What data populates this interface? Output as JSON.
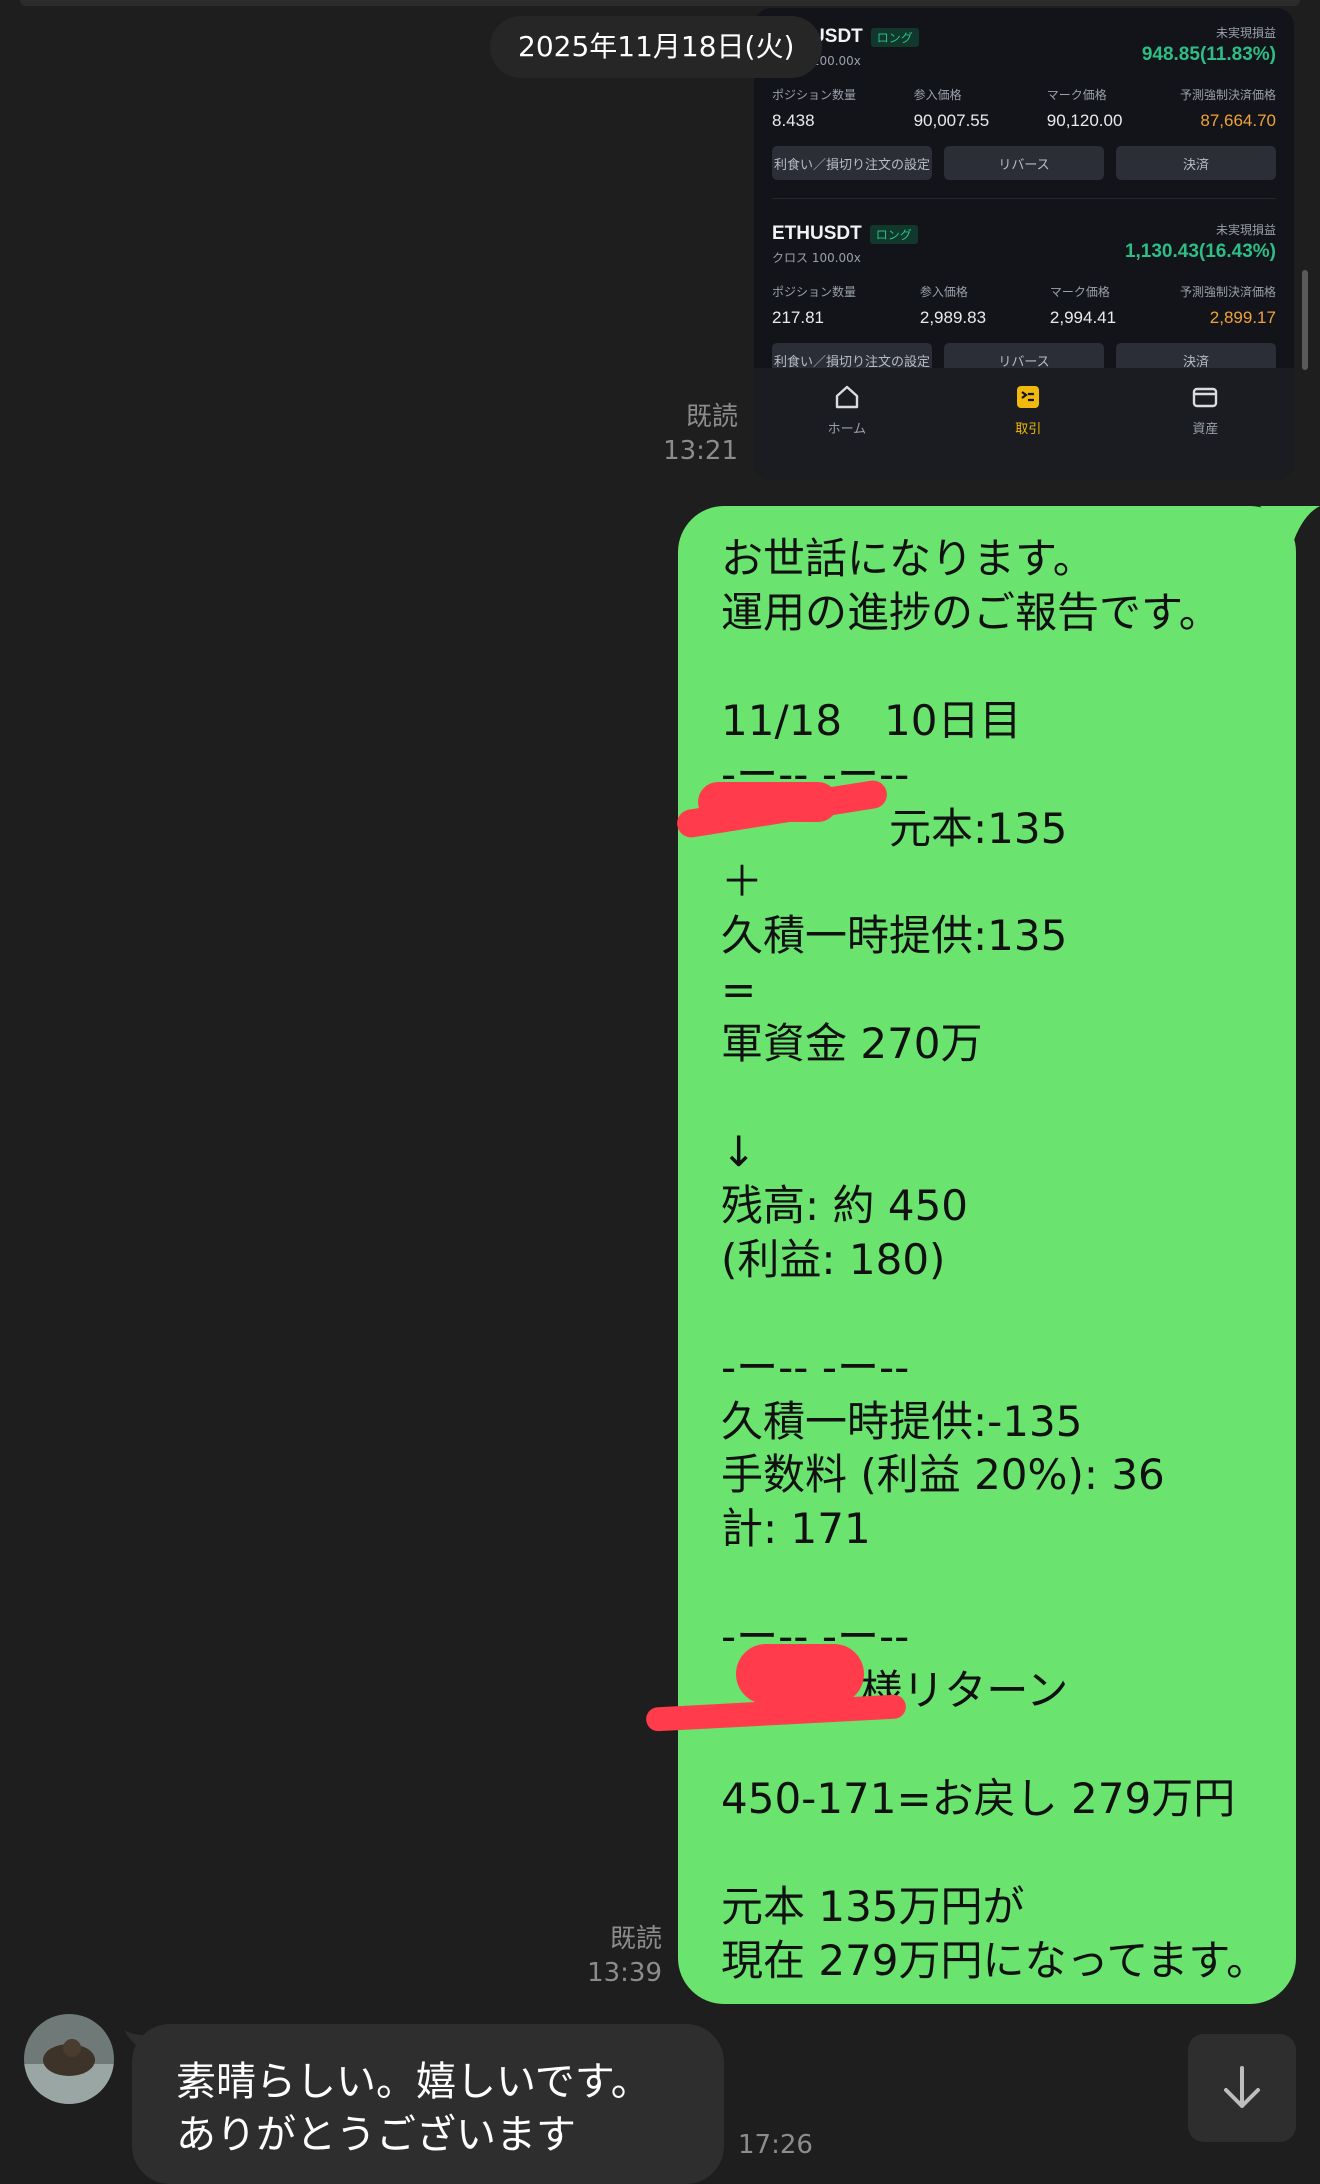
{
  "date_separator": "2025年11月18日(火)",
  "trade_screenshot": {
    "positions": [
      {
        "symbol": "BTCUSDT",
        "side": "ロング",
        "margin": "クロス 100.00x",
        "pnl_label": "未実現損益",
        "pnl_value": "948.85(11.83%)",
        "cols": [
          {
            "label": "ポジション数量",
            "value": "8.438"
          },
          {
            "label": "参入価格",
            "value": "90,007.55"
          },
          {
            "label": "マーク価格",
            "value": "90,120.00"
          },
          {
            "label": "予測強制決済価格",
            "value": "87,664.70"
          }
        ],
        "buttons": [
          "利食い／損切り注文の設定",
          "リバース",
          "決済"
        ]
      },
      {
        "symbol": "ETHUSDT",
        "side": "ロング",
        "margin": "クロス 100.00x",
        "pnl_label": "未実現損益",
        "pnl_value": "1,130.43(16.43%)",
        "cols": [
          {
            "label": "ポジション数量",
            "value": "217.81"
          },
          {
            "label": "参入価格",
            "value": "2,989.83"
          },
          {
            "label": "マーク価格",
            "value": "2,994.41"
          },
          {
            "label": "予測強制決済価格",
            "value": "2,899.17"
          }
        ],
        "buttons": [
          "利食い／損切り注文の設定",
          "リバース",
          "決済"
        ]
      }
    ],
    "tabbar": [
      {
        "label": "ホーム",
        "icon": "home-icon"
      },
      {
        "label": "取引",
        "icon": "trade-icon"
      },
      {
        "label": "資産",
        "icon": "wallet-icon"
      }
    ]
  },
  "msg1_meta": {
    "read": "既読",
    "time": "13:21"
  },
  "msg2": {
    "lines": [
      "お世話になります。",
      "運用の進捗のご報告です。",
      "",
      "11/18　10日目",
      "-ー-- -ー--",
      "　　　　元本:135",
      "＋",
      "久積一時提供:135",
      "=",
      "軍資金 270万",
      "",
      "↓",
      "残高: 約 450",
      "(利益: 180)",
      "",
      "-ー-- -ー--",
      "久積一時提供:-135",
      "手数料 (利益 20%): 36",
      "計: 171",
      "",
      "-ー-- -ー--",
      "　　　 様リターン",
      "",
      "450-171=お戻し 279万円",
      "",
      "元本 135万円が",
      "現在 279万円になってます。"
    ],
    "read": "既読",
    "time": "13:39"
  },
  "msg3": {
    "lines": [
      "素晴らしい。嬉しいです。",
      "ありがとうございます"
    ],
    "time": "17:26"
  },
  "colors": {
    "bg": "#1e1e1e",
    "sent_bubble": "#6be36f",
    "received_bubble": "#2e2e2e",
    "profit": "#2ebd85",
    "liq": "#f0a23a",
    "redaction": "#ff3b4c"
  }
}
